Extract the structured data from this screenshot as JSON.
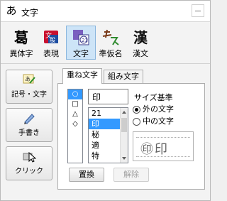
{
  "window": {
    "icon": "あ",
    "title": "文字"
  },
  "toolbar": {
    "items": [
      {
        "label": "異体字",
        "glyph": "葛",
        "icon": "kanji-variant-icon"
      },
      {
        "label": "表現",
        "glyph": "",
        "icon": "expression-icon"
      },
      {
        "label": "文字",
        "glyph": "",
        "icon": "character-icon",
        "active": true
      },
      {
        "label": "準仮名",
        "glyph": "",
        "icon": "quasi-kana-icon"
      },
      {
        "label": "漢文",
        "glyph": "漢",
        "icon": "kanbun-icon"
      }
    ]
  },
  "left_buttons": [
    {
      "label": "記号・文字",
      "icon": "symbol-character-icon"
    },
    {
      "label": "手書き",
      "icon": "handwriting-icon"
    },
    {
      "label": "クリック",
      "icon": "click-icon"
    }
  ],
  "tabs": [
    "重ね文字",
    "組み文字"
  ],
  "shapes": [
    "○",
    "□",
    "△",
    "◇"
  ],
  "char_input": "印",
  "char_list": [
    "21",
    "印",
    "秘",
    "適",
    "特"
  ],
  "size_basis": {
    "label": "サイズ基準",
    "options": [
      "外の文字",
      "中の文字"
    ]
  },
  "preview": {
    "text": "㊞印"
  },
  "buttons": {
    "replace": "置換",
    "release": "解除"
  },
  "colors": {
    "selection": "#3399ff",
    "active_tool": "#cde4f7"
  }
}
